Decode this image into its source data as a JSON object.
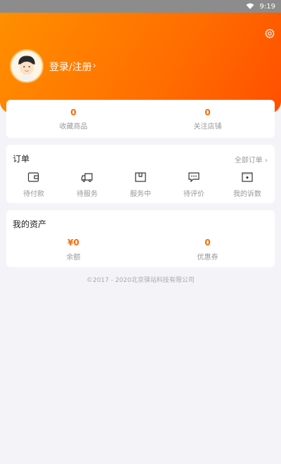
{
  "status_bar": {
    "time": "9:19",
    "wifi_icon": "wifi-icon"
  },
  "header": {
    "login_label": "登录/注册",
    "chevron": "›",
    "settings_icon": "gear-icon",
    "avatar_icon": "avatar",
    "gradient": [
      "#ff8f00",
      "#ff4f00"
    ]
  },
  "stats": [
    {
      "value": "0",
      "label": "收藏商品"
    },
    {
      "value": "0",
      "label": "关注店铺"
    }
  ],
  "orders": {
    "title": "订单",
    "more_label": "全部订单",
    "more_chevron": "›",
    "items": [
      {
        "label": "待付款",
        "icon": "wallet-icon"
      },
      {
        "label": "待服务",
        "icon": "truck-icon"
      },
      {
        "label": "服务中",
        "icon": "box-icon"
      },
      {
        "label": "待评价",
        "icon": "comment-icon"
      },
      {
        "label": "我的诉数",
        "icon": "complaint-icon"
      }
    ]
  },
  "assets": {
    "title": "我的资产",
    "items": [
      {
        "value": "¥0",
        "label": "余额"
      },
      {
        "value": "0",
        "label": "优惠券"
      }
    ]
  },
  "footer": {
    "copyright": "©2017 - 2020北京驿站科技有限公司"
  },
  "colors": {
    "accent": "#ff6a00",
    "background": "#f4f4f8"
  }
}
